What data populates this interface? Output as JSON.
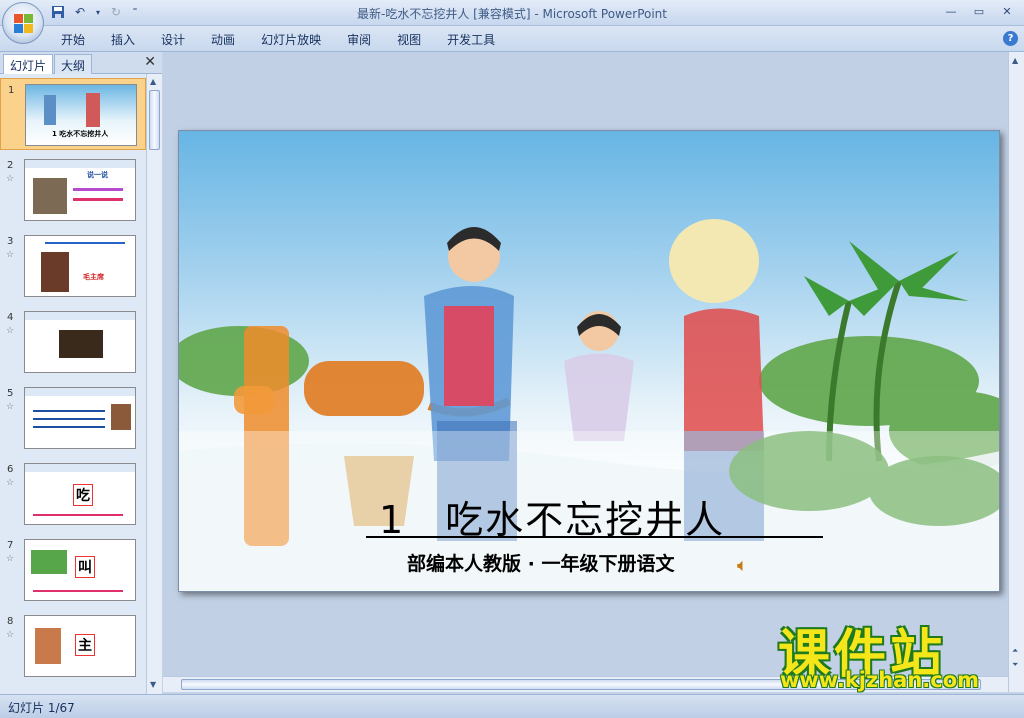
{
  "window": {
    "title": "最新-吃水不忘挖井人 [兼容模式] - Microsoft PowerPoint"
  },
  "ribbon": {
    "tabs": [
      "开始",
      "插入",
      "设计",
      "动画",
      "幻灯片放映",
      "审阅",
      "视图",
      "开发工具"
    ]
  },
  "left_panel": {
    "tab_slides": "幻灯片",
    "tab_outline": "大纲",
    "thumbnails": [
      {
        "num": "1",
        "text": "1 吃水不忘挖井人"
      },
      {
        "num": "2",
        "text": "说一说"
      },
      {
        "num": "3",
        "text": "毛主席"
      },
      {
        "num": "4",
        "text": ""
      },
      {
        "num": "5",
        "text": ""
      },
      {
        "num": "6",
        "text": "吃"
      },
      {
        "num": "7",
        "text": "叫"
      },
      {
        "num": "8",
        "text": "主"
      }
    ]
  },
  "slide": {
    "title": "1　吃水不忘挖井人",
    "subtitle": "部编本人教版 · 一年级下册语文"
  },
  "status": {
    "slide_counter": "幻灯片 1/67"
  },
  "watermark": {
    "brand": "课件站",
    "url": "www.kjzhan.com"
  },
  "colors": {
    "selected_thumb": "#fbd28c",
    "ribbon_bg": "#c8d8ee",
    "accent_title_line": "#000000"
  }
}
